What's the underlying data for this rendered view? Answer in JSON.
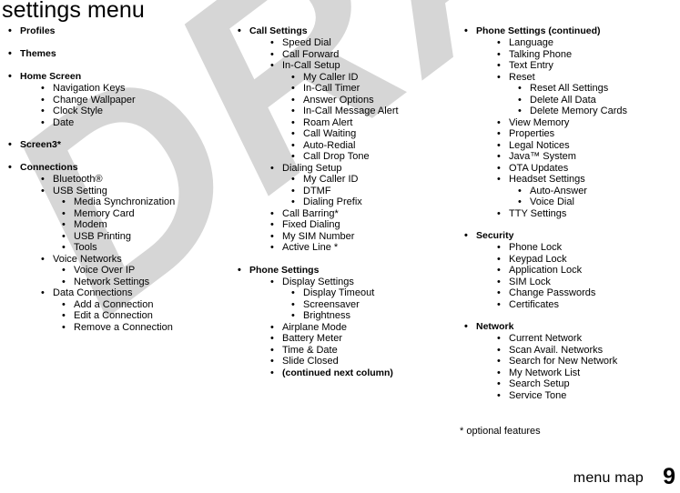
{
  "page": {
    "title": "settings menu",
    "watermark": "DRAFT",
    "watermark_color": "#d6d6d6",
    "footnote": "* optional features",
    "footer_label": "menu map",
    "page_number": "9",
    "bullet_glyph": "•"
  },
  "columns": [
    {
      "id": "column-1",
      "rows": [
        {
          "level": 1,
          "text": "Profiles"
        },
        {
          "level": 1,
          "text": "Themes"
        },
        {
          "level": 1,
          "text": "Home Screen"
        },
        {
          "level": 2,
          "text": "Navigation Keys"
        },
        {
          "level": 2,
          "text": "Change Wallpaper"
        },
        {
          "level": 2,
          "text": "Clock Style"
        },
        {
          "level": 2,
          "text": "Date"
        },
        {
          "level": 1,
          "text": "Screen3*"
        },
        {
          "level": 1,
          "text": "Connections"
        },
        {
          "level": 2,
          "text": "Bluetooth®"
        },
        {
          "level": 2,
          "text": "USB Setting"
        },
        {
          "level": 3,
          "text": "Media Synchronization"
        },
        {
          "level": 3,
          "text": "Memory Card"
        },
        {
          "level": 3,
          "text": "Modem"
        },
        {
          "level": 3,
          "text": "USB Printing"
        },
        {
          "level": 3,
          "text": "Tools"
        },
        {
          "level": 2,
          "text": "Voice Networks"
        },
        {
          "level": 3,
          "text": "Voice Over IP"
        },
        {
          "level": 3,
          "text": "Network Settings"
        },
        {
          "level": 2,
          "text": "Data Connections"
        },
        {
          "level": 3,
          "text": "Add a Connection"
        },
        {
          "level": 3,
          "text": "Edit a Connection"
        },
        {
          "level": 3,
          "text": "Remove a Connection"
        }
      ]
    },
    {
      "id": "column-2",
      "rows": [
        {
          "level": 1,
          "text": "Call Settings"
        },
        {
          "level": 2,
          "text": "Speed Dial"
        },
        {
          "level": 2,
          "text": "Call Forward"
        },
        {
          "level": 2,
          "text": "In-Call Setup"
        },
        {
          "level": 3,
          "text": "My Caller ID"
        },
        {
          "level": 3,
          "text": "In-Call Timer"
        },
        {
          "level": 3,
          "text": "Answer Options"
        },
        {
          "level": 3,
          "text": "In-Call Message Alert"
        },
        {
          "level": 3,
          "text": "Roam Alert"
        },
        {
          "level": 3,
          "text": "Call Waiting"
        },
        {
          "level": 3,
          "text": "Auto-Redial"
        },
        {
          "level": 3,
          "text": "Call Drop Tone"
        },
        {
          "level": 2,
          "text": "Dialing Setup"
        },
        {
          "level": 3,
          "text": "My Caller ID"
        },
        {
          "level": 3,
          "text": "DTMF"
        },
        {
          "level": 3,
          "text": "Dialing Prefix"
        },
        {
          "level": 2,
          "text": "Call Barring*"
        },
        {
          "level": 2,
          "text": "Fixed Dialing"
        },
        {
          "level": 2,
          "text": "My SIM Number"
        },
        {
          "level": 2,
          "text": "Active Line *"
        },
        {
          "level": 1,
          "text": "Phone Settings"
        },
        {
          "level": 2,
          "text": "Display Settings"
        },
        {
          "level": 3,
          "text": "Display Timeout"
        },
        {
          "level": 3,
          "text": "Screensaver"
        },
        {
          "level": 3,
          "text": "Brightness"
        },
        {
          "level": 2,
          "text": "Airplane Mode"
        },
        {
          "level": 2,
          "text": "Battery Meter"
        },
        {
          "level": 2,
          "text": "Time & Date"
        },
        {
          "level": 2,
          "text": "Slide Closed"
        },
        {
          "level": 2,
          "text": "(continued next column)",
          "bold": true
        }
      ]
    },
    {
      "id": "column-3",
      "rows": [
        {
          "level": 1,
          "text": "Phone Settings (continued)"
        },
        {
          "level": 2,
          "text": "Language"
        },
        {
          "level": 2,
          "text": "Talking Phone"
        },
        {
          "level": 2,
          "text": "Text Entry"
        },
        {
          "level": 2,
          "text": "Reset"
        },
        {
          "level": 3,
          "text": "Reset All Settings"
        },
        {
          "level": 3,
          "text": "Delete All Data"
        },
        {
          "level": 3,
          "text": "Delete Memory Cards"
        },
        {
          "level": 2,
          "text": "View Memory"
        },
        {
          "level": 2,
          "text": "Properties"
        },
        {
          "level": 2,
          "text": "Legal Notices"
        },
        {
          "level": 2,
          "text": "Java™ System"
        },
        {
          "level": 2,
          "text": "OTA Updates"
        },
        {
          "level": 2,
          "text": "Headset Settings"
        },
        {
          "level": 3,
          "text": "Auto-Answer"
        },
        {
          "level": 3,
          "text": "Voice Dial"
        },
        {
          "level": 2,
          "text": "TTY Settings"
        },
        {
          "level": 1,
          "text": "Security"
        },
        {
          "level": 2,
          "text": "Phone Lock"
        },
        {
          "level": 2,
          "text": "Keypad Lock"
        },
        {
          "level": 2,
          "text": "Application Lock"
        },
        {
          "level": 2,
          "text": "SIM Lock"
        },
        {
          "level": 2,
          "text": "Change Passwords"
        },
        {
          "level": 2,
          "text": "Certificates"
        },
        {
          "level": 1,
          "text": "Network"
        },
        {
          "level": 2,
          "text": "Current Network"
        },
        {
          "level": 2,
          "text": "Scan Avail. Networks"
        },
        {
          "level": 2,
          "text": "Search for New Network"
        },
        {
          "level": 2,
          "text": "My Network List"
        },
        {
          "level": 2,
          "text": "Search Setup"
        },
        {
          "level": 2,
          "text": "Service Tone"
        }
      ]
    }
  ]
}
